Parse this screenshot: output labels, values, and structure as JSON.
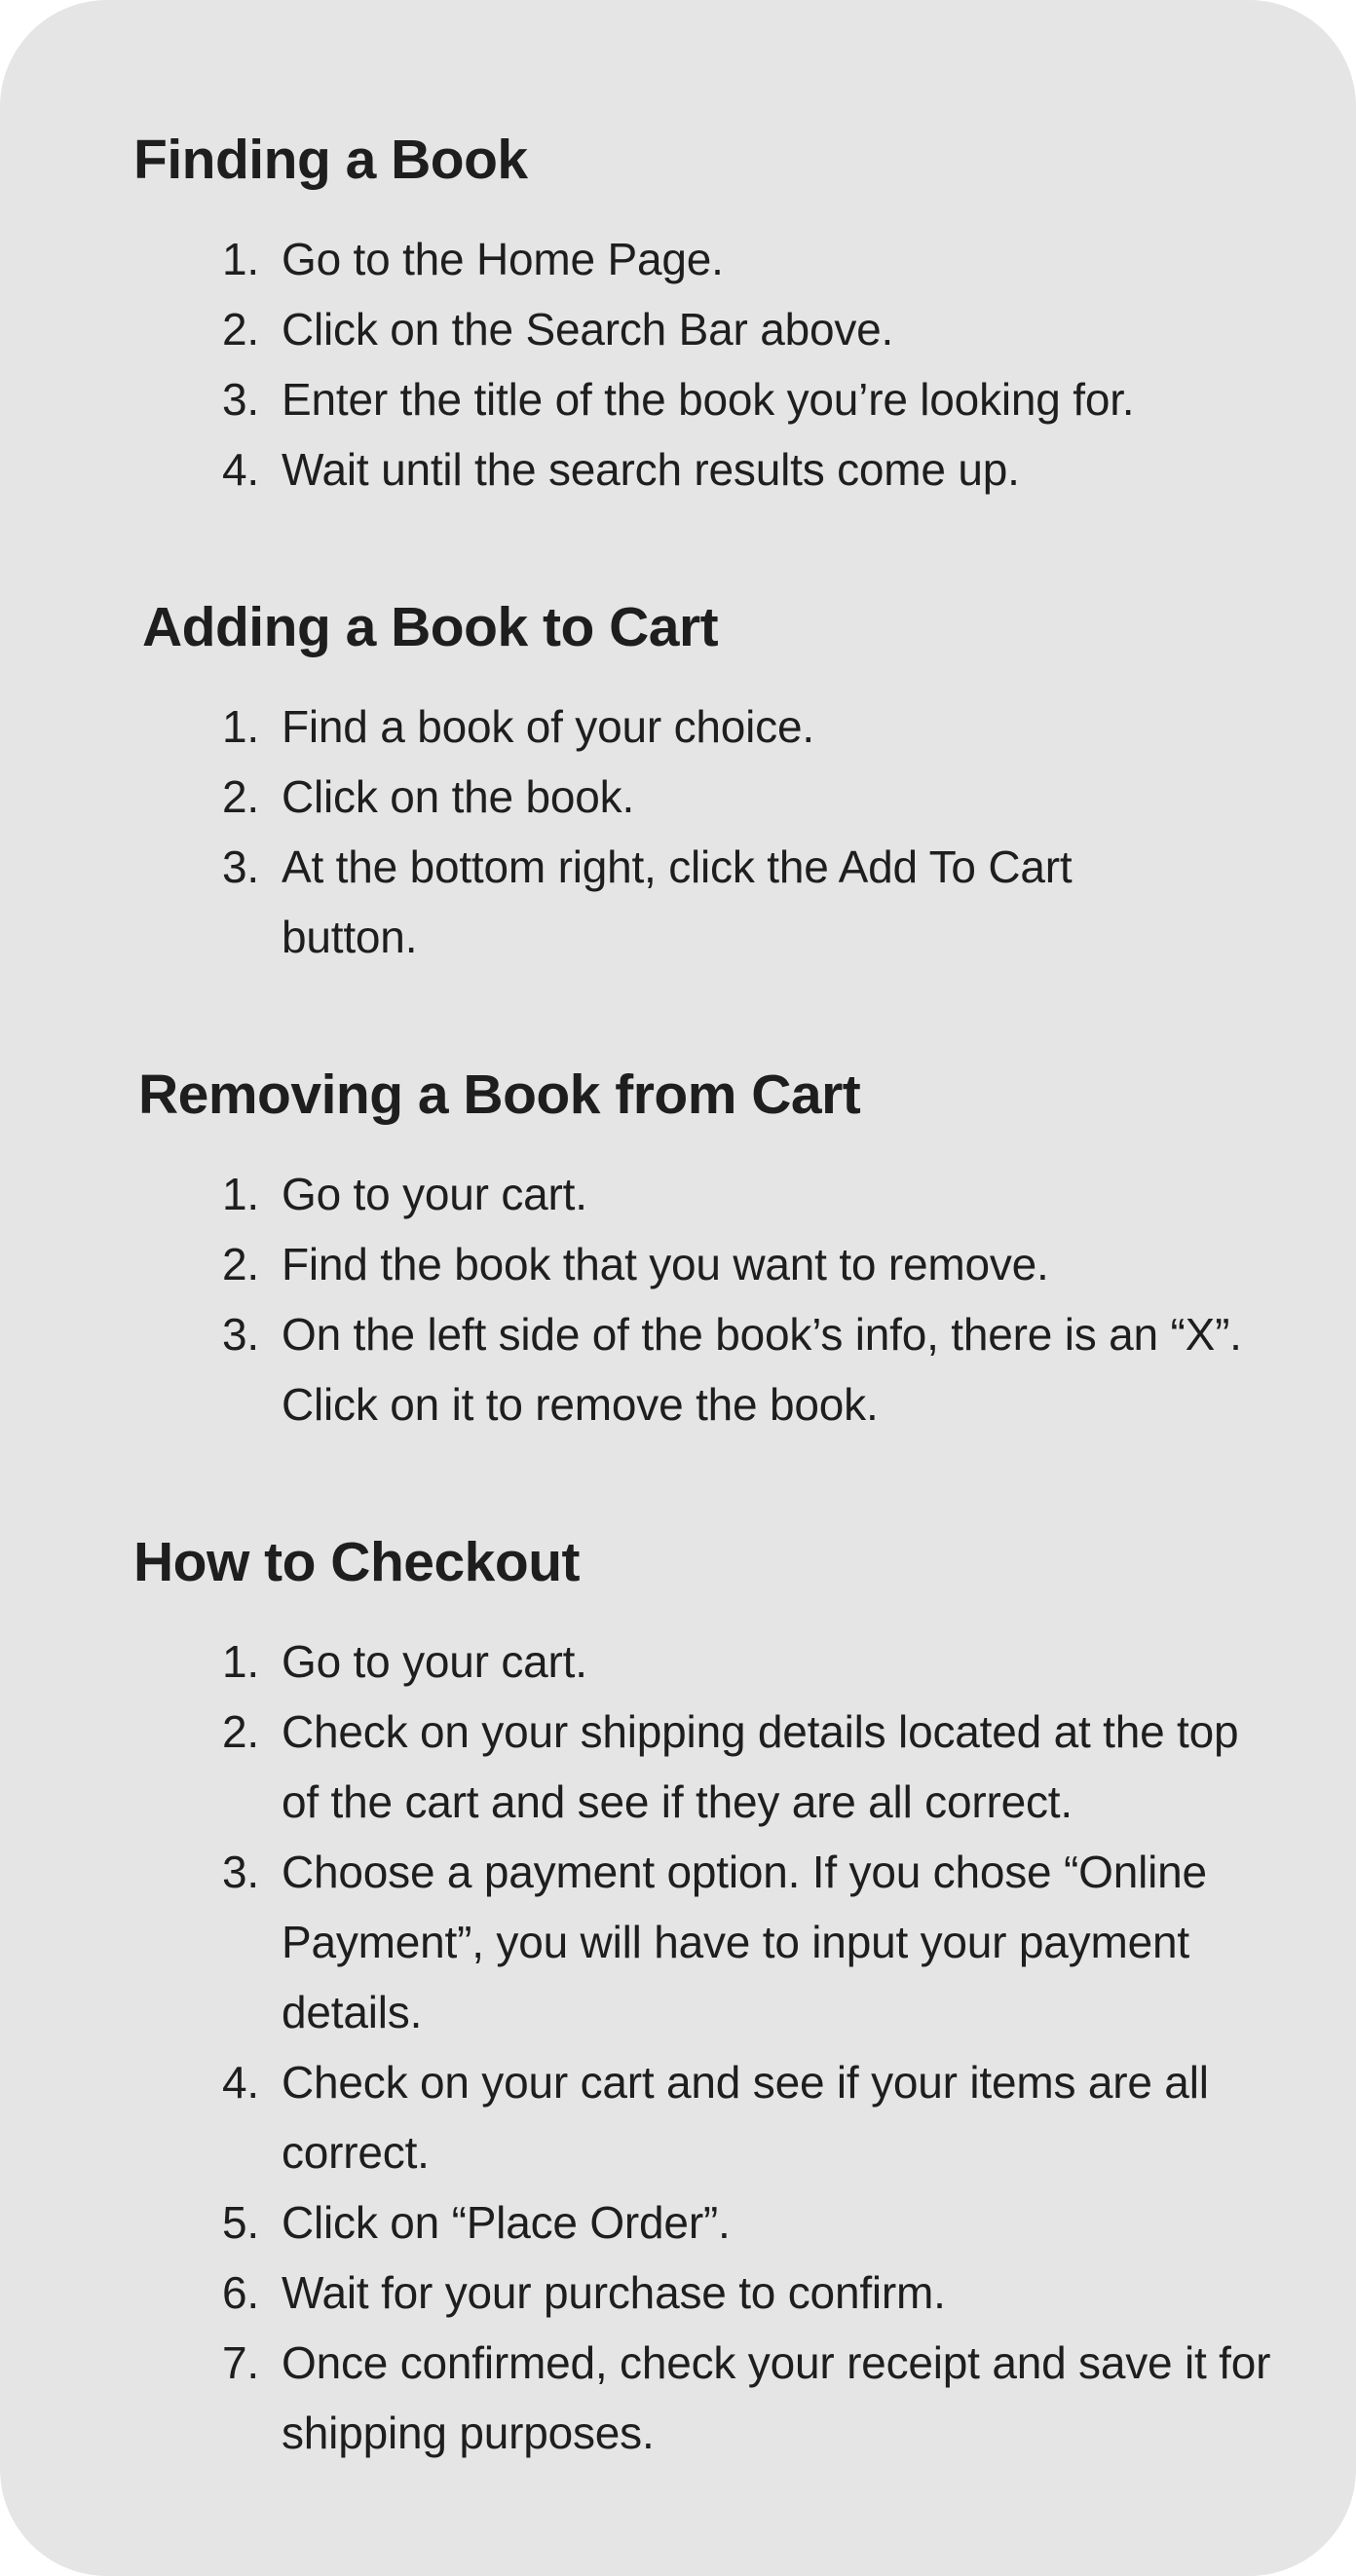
{
  "sections": [
    {
      "title": "Finding a Book",
      "steps": [
        "Go to the Home Page.",
        "Click on the Search Bar above.",
        "Enter the title of the book you’re looking for.",
        "Wait until the search results come up."
      ]
    },
    {
      "title": "Adding a Book to Cart",
      "steps": [
        "Find a book of your choice.",
        "Click on the book.",
        "At the bottom right, click the Add To Cart button."
      ]
    },
    {
      "title": "Removing a Book from Cart",
      "steps": [
        "Go to your cart.",
        "Find the book that you want to remove.",
        "On the left side of the book’s info, there is an “X”. Click on it to remove the book."
      ]
    },
    {
      "title": "How to Checkout",
      "steps": [
        "Go to your cart.",
        "Check on your shipping details located at the top of the cart and see if they are all correct.",
        "Choose a payment option. If you chose “Online Payment”, you will have to input your payment details.",
        "Check on your cart and see if your items are all correct.",
        "Click on “Place Order”.",
        "Wait for your purchase to confirm.",
        "Once confirmed, check your receipt and save it for shipping purposes."
      ]
    }
  ],
  "numbers": [
    "1.",
    "2.",
    "3.",
    "4.",
    "5.",
    "6.",
    "7."
  ]
}
